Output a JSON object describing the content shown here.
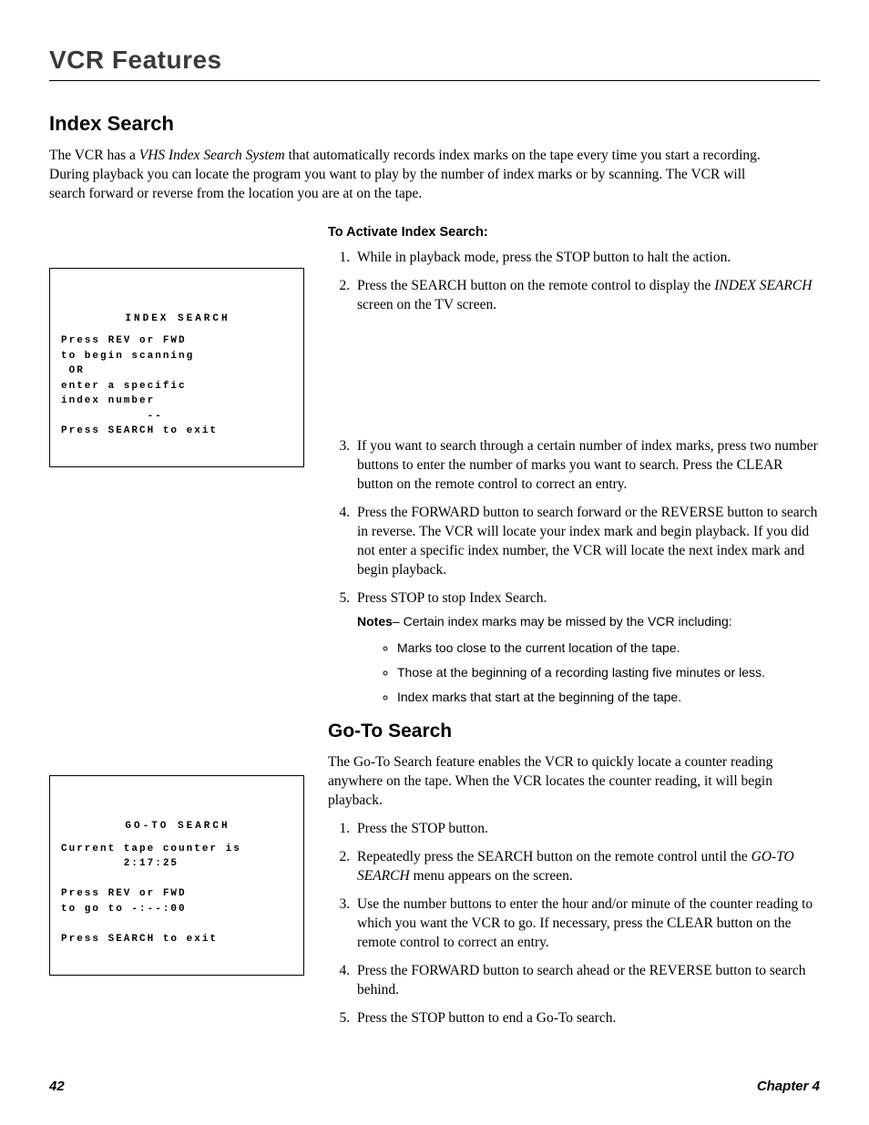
{
  "chapterTitle": "VCR Features",
  "section1": {
    "heading": "Index Search",
    "intro_pre": "The VCR has a ",
    "intro_em": "VHS Index Search System",
    "intro_post": " that automatically records index marks on the tape every time you start a recording. During playback you can locate the program you want to play by the number of index marks or by scanning. The VCR will search forward or reverse from the location you are at on the tape.",
    "screen_title": "INDEX SEARCH",
    "screen_body": "Press REV or FWD\nto begin scanning\n OR\nenter a specific\nindex number\n           --\nPress SEARCH to exit",
    "activate_label": "To Activate Index Search:",
    "steps": {
      "s1": "While in playback mode, press the STOP button to halt the action.",
      "s2_pre": "Press the SEARCH button on the remote control to display the ",
      "s2_em": "INDEX SEARCH",
      "s2_post": " screen on the TV screen.",
      "s3": "If you want to search through a certain number of index marks, press two number buttons to enter the number of marks you want to search. Press the CLEAR button on the remote control to correct an entry.",
      "s4": "Press the FORWARD button to search forward or the REVERSE button to search in reverse. The VCR will locate your index mark and begin playback. If you did not enter a specific index number, the VCR will locate the next index mark and begin playback.",
      "s5_main": "Press STOP to stop Index Search.",
      "s5_notes_label": "Notes",
      "s5_notes_text": "– Certain index marks may be missed by the VCR including:",
      "bullets": {
        "b1": "Marks too close to the current location of the tape.",
        "b2": "Those at the beginning of a recording lasting five minutes or less.",
        "b3": "Index marks that start at the beginning of the tape."
      }
    }
  },
  "section2": {
    "heading": "Go-To Search",
    "intro": "The Go-To Search feature enables the VCR to quickly locate a counter reading anywhere on the tape. When the VCR locates the counter reading, it will begin playback.",
    "screen_title": "GO-TO SEARCH",
    "screen_body": "Current tape counter is\n        2:17:25\n\nPress REV or FWD\nto go to -:--:00\n\nPress SEARCH to exit",
    "steps": {
      "s1": "Press the STOP button.",
      "s2_pre": "Repeatedly press the SEARCH button on the remote control until the ",
      "s2_em": "GO-TO SEARCH",
      "s2_post": " menu appears on the screen.",
      "s3": "Use the number buttons to enter the hour and/or minute of the counter reading to which you want the VCR to go. If necessary, press the CLEAR button on the remote control to correct an entry.",
      "s4": "Press the FORWARD button to search ahead or the REVERSE button to search behind.",
      "s5": "Press the STOP button to end a Go-To search."
    }
  },
  "footer": {
    "page": "42",
    "chapter": "Chapter 4"
  }
}
